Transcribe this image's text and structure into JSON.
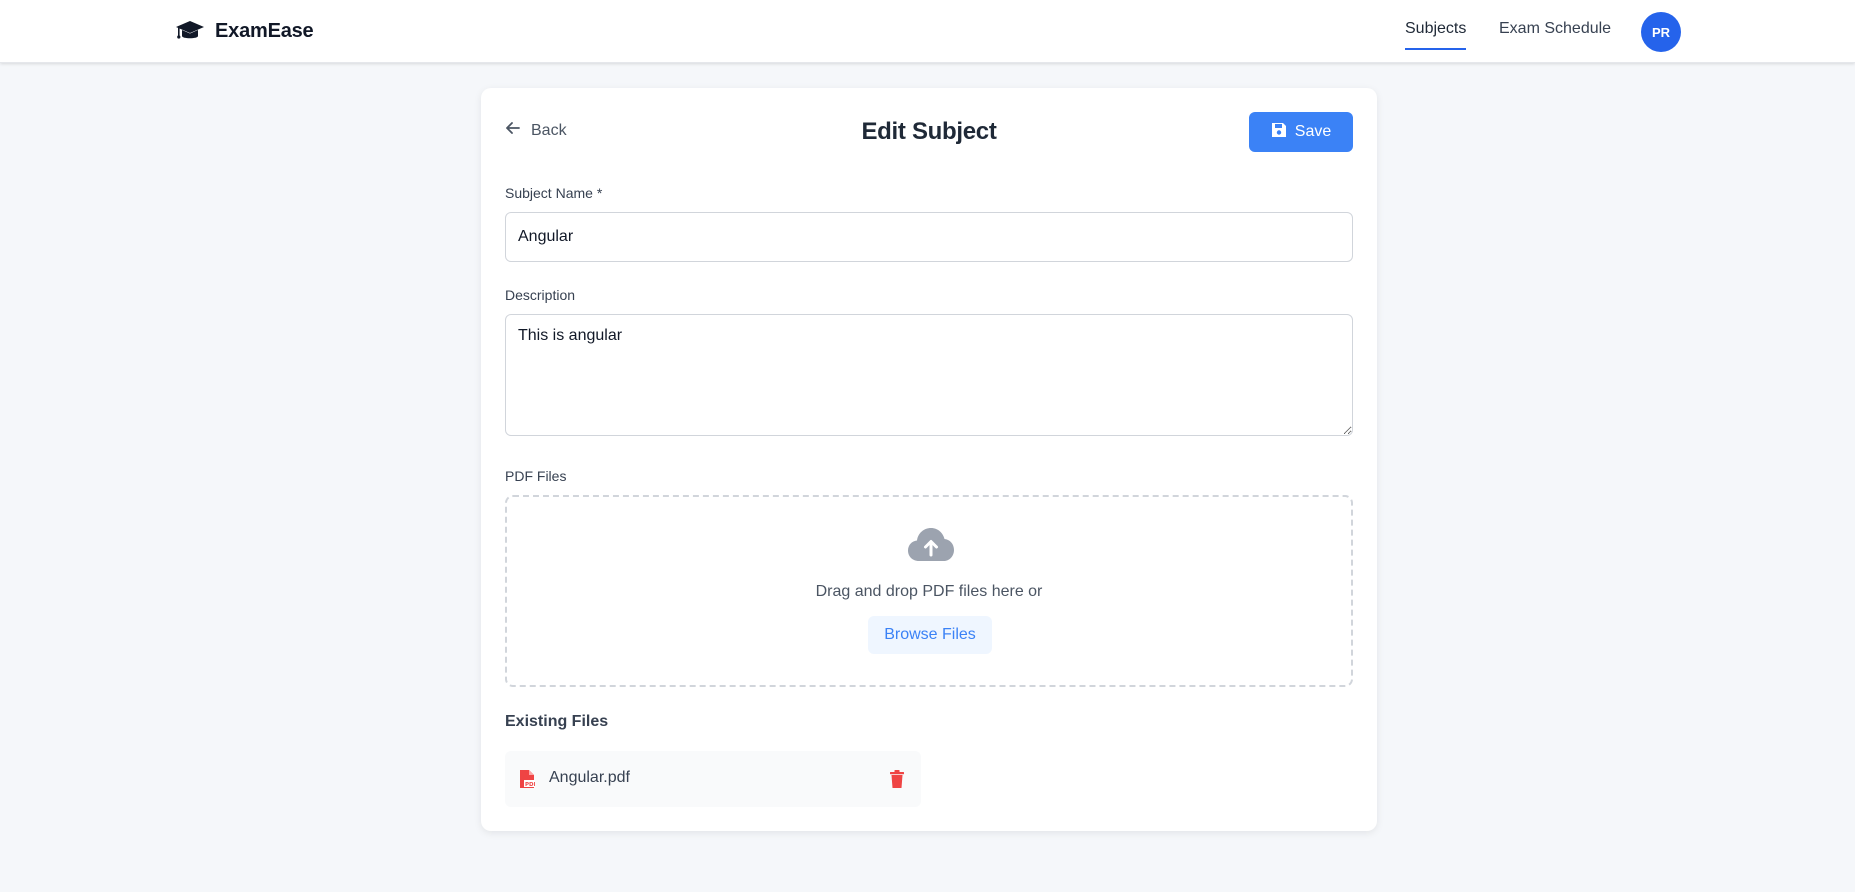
{
  "header": {
    "brand": "ExamEase",
    "nav": {
      "subjects": "Subjects",
      "exam_schedule": "Exam Schedule"
    },
    "avatar_initials": "PR"
  },
  "page": {
    "back_label": "Back",
    "title": "Edit Subject",
    "save_label": "Save"
  },
  "form": {
    "subject_name_label": "Subject Name *",
    "subject_name_value": "Angular",
    "description_label": "Description",
    "description_value": "This is angular",
    "pdf_label": "PDF Files",
    "drop_text": "Drag and drop PDF files here or",
    "browse_label": "Browse Files"
  },
  "existing": {
    "title": "Existing Files",
    "files": [
      {
        "name": "Angular.pdf"
      }
    ]
  },
  "colors": {
    "accent": "#3b82f6",
    "nav_active": "#2563eb",
    "danger": "#ef4444",
    "pdf_icon": "#ef4444"
  },
  "icons": {
    "brand": "graduation-cap-icon",
    "back": "arrow-left-icon",
    "save": "floppy-disk-icon",
    "upload": "cloud-upload-icon",
    "file": "file-pdf-icon",
    "delete": "trash-icon"
  }
}
